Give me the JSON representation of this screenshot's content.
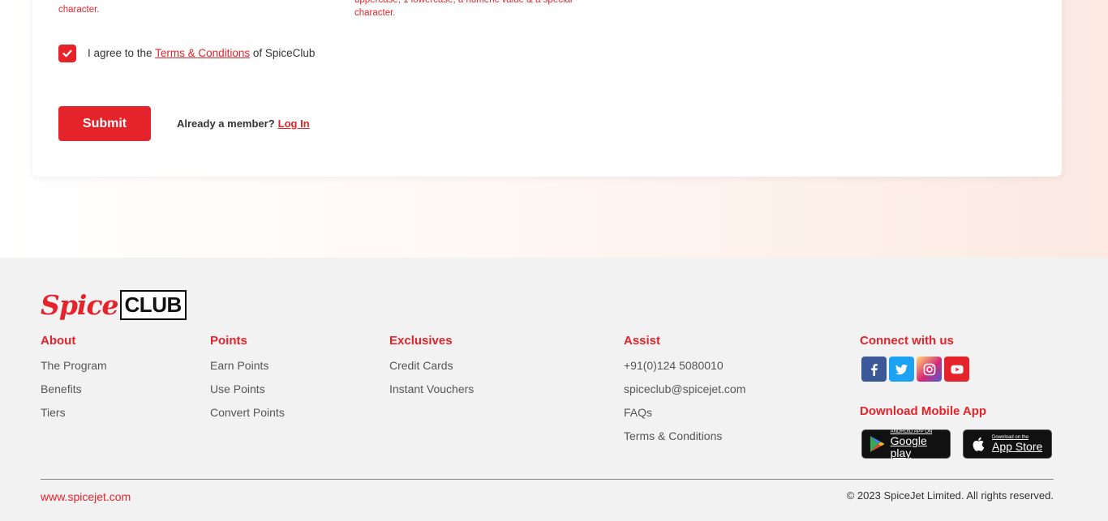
{
  "form": {
    "hint_left": "character.",
    "hint_right_line1": "uppercase, 1 lowercase, a numeric value & a special",
    "hint_right_line2": "character.",
    "agree_prefix": "I agree to the",
    "terms_link": "Terms & Conditions",
    "agree_suffix": "of SpiceClub",
    "submit_label": "Submit",
    "member_prompt": "Already a member?",
    "login_link": "Log In"
  },
  "footer": {
    "logo": {
      "spice": "Spice",
      "club": "CLUB"
    },
    "columns": {
      "about": {
        "title": "About",
        "items": [
          "The Program",
          "Benefits",
          "Tiers"
        ]
      },
      "points": {
        "title": "Points",
        "items": [
          "Earn Points",
          "Use Points",
          "Convert Points"
        ]
      },
      "exclusives": {
        "title": "Exclusives",
        "items": [
          "Credit Cards",
          "Instant Vouchers"
        ]
      },
      "assist": {
        "title": "Assist",
        "items": [
          "+91(0)124 5080010",
          "spiceclub@spicejet.com",
          "FAQs",
          "Terms & Conditions"
        ]
      },
      "connect": {
        "title": "Connect with us"
      }
    },
    "social_icons": [
      "facebook-icon",
      "twitter-icon",
      "instagram-icon",
      "youtube-icon"
    ],
    "download_title": "Download Mobile App",
    "google_play": {
      "small": "ANDROID APP ON",
      "big": "Google play"
    },
    "app_store": {
      "small": "Download on the",
      "big": "App Store"
    },
    "site_link": "www.spicejet.com",
    "copyright": "© 2023 SpiceJet Limited. All rights reserved."
  },
  "colors": {
    "brand_red": "#e4232a",
    "footer_bg": "#f2f2f2"
  }
}
